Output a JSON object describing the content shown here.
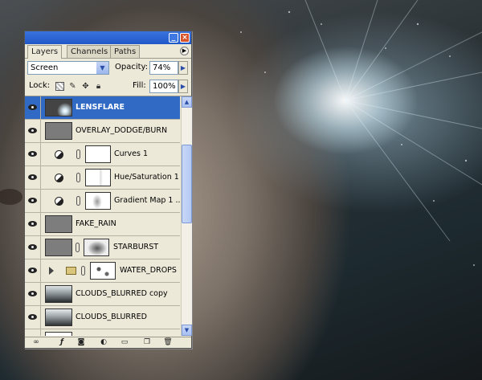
{
  "colors": {
    "selection": "#316ac5",
    "titlebar": "#2158c8",
    "panel_bg": "#ece9d8"
  },
  "panel": {
    "tabs": [
      {
        "label": "Layers",
        "active": true
      },
      {
        "label": "Channels",
        "active": false
      },
      {
        "label": "Paths",
        "active": false
      }
    ],
    "blend_mode": "Screen",
    "opacity_label": "Opacity:",
    "opacity_value": "74%",
    "lock_label": "Lock:",
    "fill_label": "Fill:",
    "fill_value": "100%"
  },
  "layers": [
    {
      "name": "LENSFLARE",
      "selected": true,
      "kind": "pixel"
    },
    {
      "name": "OVERLAY_DODGE/BURN",
      "selected": false,
      "kind": "pixel"
    },
    {
      "name": "Curves 1",
      "selected": false,
      "kind": "adjustment"
    },
    {
      "name": "Hue/Saturation 1",
      "selected": false,
      "kind": "adjustment"
    },
    {
      "name": "Gradient Map 1 ...",
      "selected": false,
      "kind": "adjustment"
    },
    {
      "name": "FAKE_RAIN",
      "selected": false,
      "kind": "pixel"
    },
    {
      "name": "STARBURST",
      "selected": false,
      "kind": "masked"
    },
    {
      "name": "WATER_DROPS",
      "selected": false,
      "kind": "group"
    },
    {
      "name": "CLOUDS_BLURRED copy",
      "selected": false,
      "kind": "pixel"
    },
    {
      "name": "CLOUDS_BLURRED",
      "selected": false,
      "kind": "pixel"
    }
  ],
  "icons": {
    "eye": "eye-icon",
    "link": "link-layers-icon",
    "fx": "layer-style-icon",
    "mask": "add-mask-icon",
    "adjust": "new-adjustment-layer-icon",
    "group": "new-group-icon",
    "new": "new-layer-icon",
    "delete": "trash-icon"
  }
}
